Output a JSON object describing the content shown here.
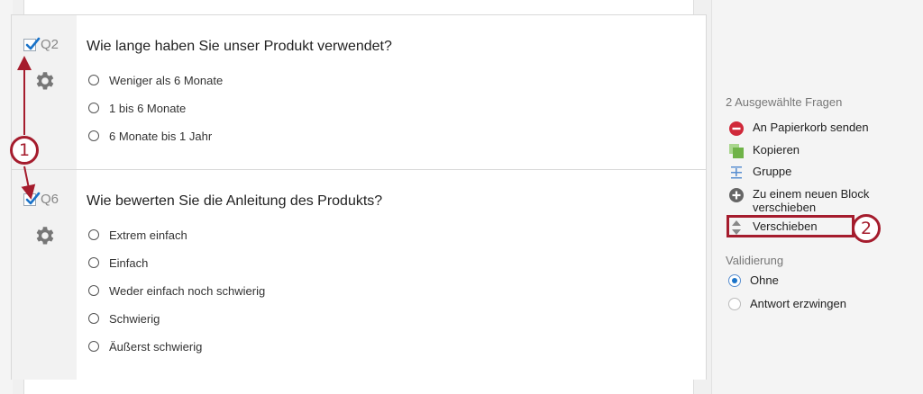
{
  "questions": [
    {
      "number": "Q2",
      "title": "Wie lange haben Sie unser Produkt verwendet?",
      "checked": true,
      "options": [
        "Weniger als 6 Monate",
        "1 bis 6 Monate",
        "6 Monate bis 1 Jahr"
      ]
    },
    {
      "number": "Q6",
      "title": "Wie bewerten Sie die Anleitung des Produkts?",
      "checked": true,
      "options": [
        "Extrem einfach",
        "Einfach",
        "Weder einfach noch schwierig",
        "Schwierig",
        "Äußerst schwierig"
      ]
    }
  ],
  "sidebar": {
    "heading": "2 Ausgewählte Fragen",
    "actions": [
      {
        "label": "An Papierkorb senden",
        "icon": "trash-icon",
        "color": "#d0293a"
      },
      {
        "label": "Kopieren",
        "icon": "copy-icon",
        "color": "#7bbf5a"
      },
      {
        "label": "Gruppe",
        "icon": "group-icon",
        "color": "#5a8fd0"
      },
      {
        "label_line1": "Zu einem neuen Block",
        "label_line2": "verschieben",
        "icon": "plus-circle-icon",
        "color": "#666666"
      },
      {
        "label": "Verschieben",
        "icon": "move-arrows-icon",
        "color": "#888888"
      }
    ],
    "validation_heading": "Validierung",
    "validation_options": [
      {
        "label": "Ohne",
        "selected": true
      },
      {
        "label": "Antwort erzwingen",
        "selected": false
      }
    ]
  },
  "annotations": {
    "badge1": "1",
    "badge2": "2",
    "color": "#a51c2d"
  }
}
